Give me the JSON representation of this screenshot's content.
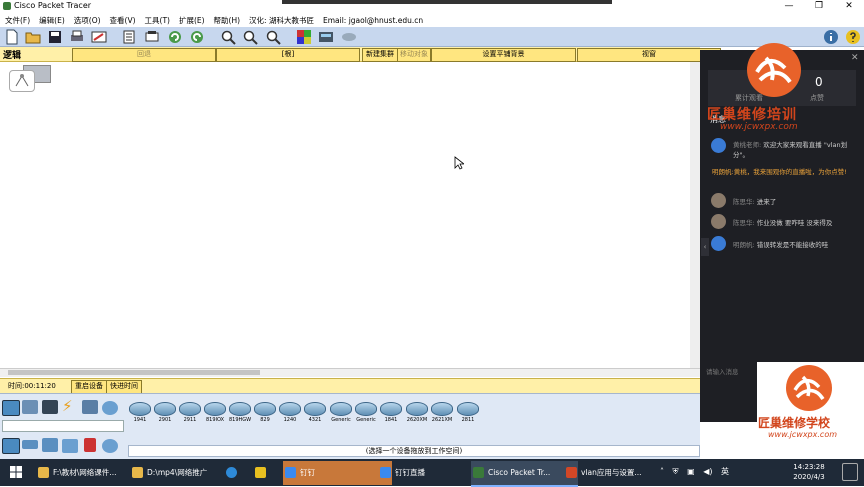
{
  "window": {
    "title": "Cisco Packet Tracer",
    "min": "—",
    "max": "❐",
    "close": "✕"
  },
  "menu": [
    "文件(F)",
    "编辑(E)",
    "选项(O)",
    "查看(V)",
    "工具(T)",
    "扩展(E)",
    "帮助(H)",
    "汉化: 湖科大教书匠",
    "Email: jgaol@hnust.edu.cn"
  ],
  "toolbar_icons": [
    "new-icon",
    "open-icon",
    "save-icon",
    "print-icon",
    "activity-wizard-icon",
    "copy-icon",
    "paste-icon",
    "undo-icon",
    "redo-icon",
    "zoom-in-icon",
    "zoom-reset-icon",
    "zoom-out-icon",
    "palette-icon",
    "custom-device-icon",
    "cluster-icon"
  ],
  "logical_bar": {
    "label": "逻辑",
    "back": "回退",
    "root": "[根]",
    "new_cluster": "新建集群",
    "move_object": "移动对象",
    "set_background": "设置平铺背景",
    "viewport": "视窗"
  },
  "time_bar": {
    "time": "时间:00:11:20",
    "reset": "重启设备",
    "fast_forward": "快进时间"
  },
  "devices": [
    "1941",
    "2901",
    "2911",
    "819IOX",
    "819HGW",
    "829",
    "1240",
    "4321",
    "Generic",
    "Generic",
    "1841",
    "2620XM",
    "2621XM",
    "2811"
  ],
  "status_message": "(选择一个设备拖放到工作空间)",
  "chat": {
    "stat_value": "0",
    "stat_left": "累计观看",
    "stat_right": "点赞",
    "msg_header": "消息",
    "messages": [
      {
        "name": "黄桃老师:",
        "text": "欢迎大家来观看直播 \"vlan划分\"。"
      },
      {
        "name": "明朗帆:",
        "text": "黄桃，我来围观你的直播啦，为你点赞!"
      },
      {
        "name": "陈思华:",
        "text": "进来了"
      },
      {
        "name": "陈思华:",
        "text": "作业没做  要咋哇 没来得及"
      },
      {
        "name": "明朗帆:",
        "text": "错误转发是不能接收的哇"
      }
    ],
    "input_placeholder": "请输入消息"
  },
  "watermark": {
    "text1": "匠巢维修培训",
    "url1": "www.jcwxpx.com",
    "text2": "匠巢维修学校",
    "url2": "www.jcwxpx.com"
  },
  "taskbar": {
    "items": [
      "F:\\教材\\网络课件...",
      "D:\\mp4\\网络推广",
      "",
      "",
      "钉钉",
      "钉钉直播",
      "Cisco Packet Tr...",
      "vlan应用与设置..."
    ],
    "time": "14:23:28",
    "date": "2020/4/3"
  },
  "colors": {
    "accent": "#c8783a",
    "watermark": "#d2451c",
    "strip": "#fff0a8",
    "toolbar": "#c7d7ee"
  }
}
